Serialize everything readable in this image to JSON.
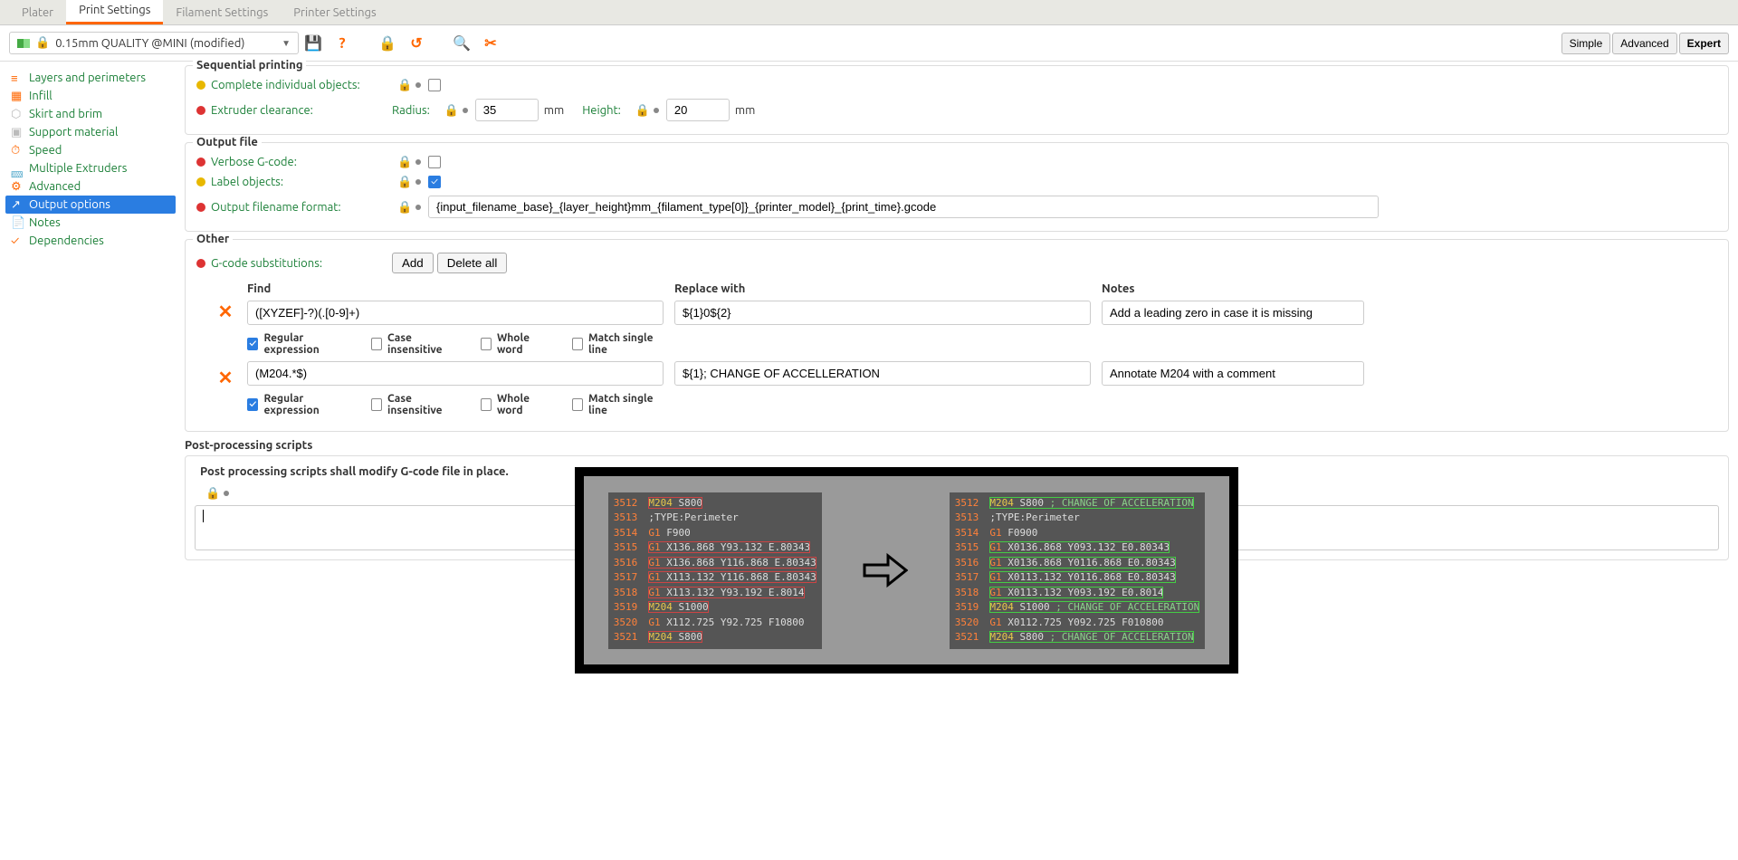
{
  "tabs": {
    "plater": "Plater",
    "print": "Print Settings",
    "filament": "Filament Settings",
    "printer": "Printer Settings"
  },
  "preset": {
    "name": "0.15mm QUALITY @MINI (modified)"
  },
  "modes": {
    "simple": "Simple",
    "advanced": "Advanced",
    "expert": "Expert"
  },
  "sidebar": {
    "layers": "Layers and perimeters",
    "infill": "Infill",
    "skirt": "Skirt and brim",
    "support": "Support material",
    "speed": "Speed",
    "multi": "Multiple Extruders",
    "advanced": "Advanced",
    "output": "Output options",
    "notes": "Notes",
    "deps": "Dependencies"
  },
  "seq": {
    "title": "Sequential printing",
    "complete": "Complete individual objects:",
    "extclr": "Extruder clearance:",
    "radius_lbl": "Radius:",
    "radius": "35",
    "mm1": "mm",
    "height_lbl": "Height:",
    "height": "20",
    "mm2": "mm"
  },
  "outf": {
    "title": "Output file",
    "verbose": "Verbose G-code:",
    "labelobj": "Label objects:",
    "fmt_lbl": "Output filename format:",
    "fmt": "{input_filename_base}_{layer_height}mm_{filament_type[0]}_{printer_model}_{print_time}.gcode"
  },
  "other": {
    "title": "Other",
    "subs_lbl": "G-code substitutions:",
    "add": "Add",
    "delall": "Delete all",
    "find_hdr": "Find",
    "repl_hdr": "Replace with",
    "notes_hdr": "Notes",
    "row1": {
      "find": "([XYZEF]-?)(.[0-9]+)",
      "repl": "${1}0${2}",
      "notes": "Add a leading zero in case it is missing"
    },
    "row2": {
      "find": "(M204.*$)",
      "repl": "${1}; CHANGE OF ACCELLERATION",
      "notes": "Annotate M204 with a comment"
    },
    "opt_regex": "Regular expression",
    "opt_case": "Case insensitive",
    "opt_whole": "Whole word",
    "opt_single": "Match single line"
  },
  "pp": {
    "title": "Post-processing scripts",
    "note": "Post processing scripts shall modify G-code file in place."
  },
  "gcode": {
    "left": [
      {
        "n": "3512",
        "cmd": "M204",
        "args": "S800",
        "box": "r"
      },
      {
        "n": "3513",
        "cmd": "",
        "args": ";TYPE:Perimeter"
      },
      {
        "n": "3514",
        "cmd": "G1",
        "args": "F900"
      },
      {
        "n": "3515",
        "cmd": "G1",
        "args": "X136.868 Y93.132 E.80343",
        "box": "r"
      },
      {
        "n": "3516",
        "cmd": "G1",
        "args": "X136.868 Y116.868 E.80343",
        "box": "r"
      },
      {
        "n": "3517",
        "cmd": "G1",
        "args": "X113.132 Y116.868 E.80343",
        "box": "r"
      },
      {
        "n": "3518",
        "cmd": "G1",
        "args": "X113.132 Y93.192 E.8014",
        "box": "r"
      },
      {
        "n": "3519",
        "cmd": "M204",
        "args": "S1000",
        "box": "r"
      },
      {
        "n": "3520",
        "cmd": "G1",
        "args": "X112.725 Y92.725 F10800"
      },
      {
        "n": "3521",
        "cmd": "M204",
        "args": "S800",
        "box": "r"
      }
    ],
    "right": [
      {
        "n": "3512",
        "cmd": "M204",
        "args": "S800",
        "cmt": " ; CHANGE OF ACCELERATION",
        "box": "g"
      },
      {
        "n": "3513",
        "cmd": "",
        "args": ";TYPE:Perimeter"
      },
      {
        "n": "3514",
        "cmd": "G1",
        "args": "F0900"
      },
      {
        "n": "3515",
        "cmd": "G1",
        "args": "X0136.868 Y093.132 E0.80343",
        "box": "g"
      },
      {
        "n": "3516",
        "cmd": "G1",
        "args": "X0136.868 Y0116.868 E0.80343",
        "box": "g"
      },
      {
        "n": "3517",
        "cmd": "G1",
        "args": "X0113.132 Y0116.868 E0.80343",
        "box": "g"
      },
      {
        "n": "3518",
        "cmd": "G1",
        "args": "X0113.132 Y093.192 E0.8014",
        "box": "g"
      },
      {
        "n": "3519",
        "cmd": "M204",
        "args": "S1000",
        "cmt": " ; CHANGE OF ACCELERATION",
        "box": "g"
      },
      {
        "n": "3520",
        "cmd": "G1",
        "args": "X0112.725 Y092.725 F010800"
      },
      {
        "n": "3521",
        "cmd": "M204",
        "args": "S800",
        "cmt": " ; CHANGE OF ACCELERATION",
        "box": "g"
      }
    ]
  }
}
